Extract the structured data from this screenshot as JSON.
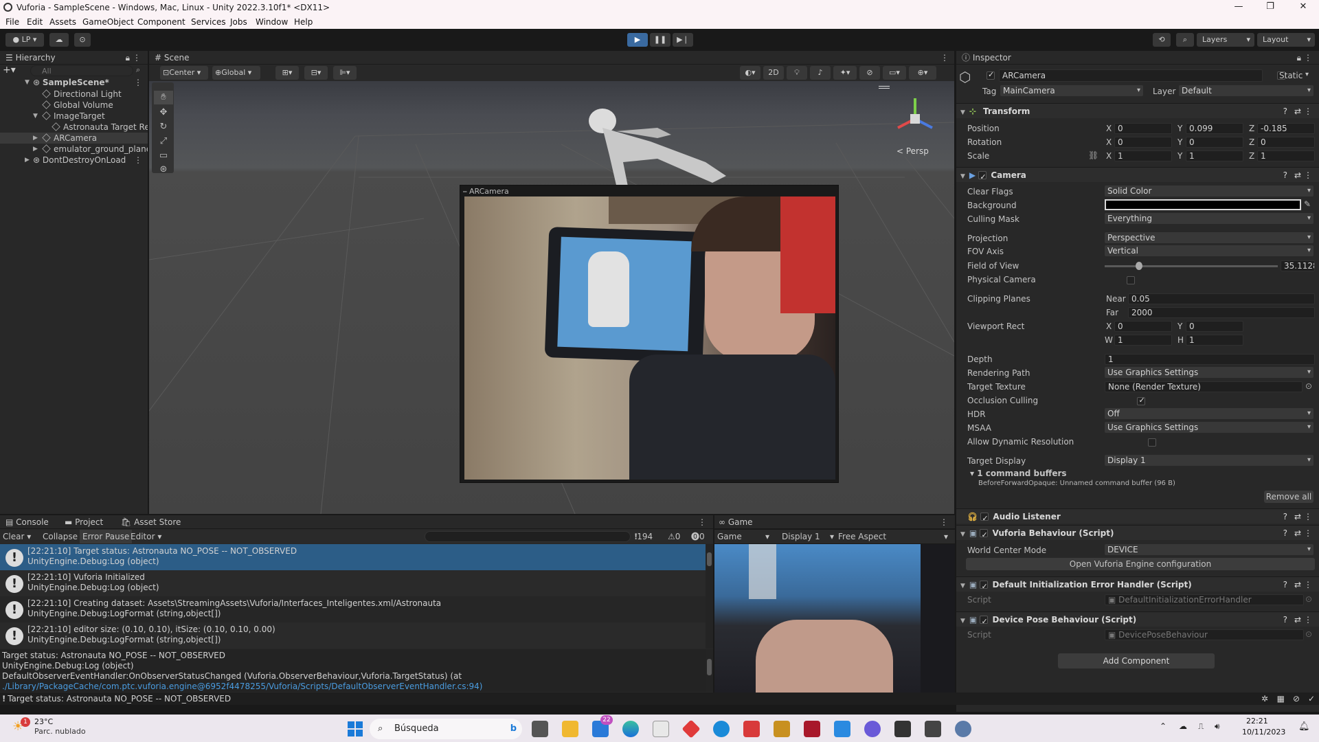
{
  "window": {
    "title": "Vuforia - SampleScene - Windows, Mac, Linux - Unity 2022.3.10f1* <DX11>"
  },
  "menu": [
    "File",
    "Edit",
    "Assets",
    "GameObject",
    "Component",
    "Services",
    "Jobs",
    "Window",
    "Help"
  ],
  "toolbar": {
    "account": "LP",
    "layers": "Layers",
    "layout": "Layout"
  },
  "hierarchy": {
    "tab": "Hierarchy",
    "search_placeholder": "All",
    "items": [
      {
        "label": "SampleScene*",
        "level": 0
      },
      {
        "label": "Directional Light",
        "level": 2
      },
      {
        "label": "Global Volume",
        "level": 2
      },
      {
        "label": "ImageTarget",
        "level": 1
      },
      {
        "label": "Astronauta Target Rep",
        "level": 3
      },
      {
        "label": "ARCamera",
        "level": 1
      },
      {
        "label": "emulator_ground_plane",
        "level": 1
      },
      {
        "label": "DontDestroyOnLoad",
        "level": 0
      }
    ]
  },
  "scene": {
    "tab": "Scene",
    "pivot": "Center",
    "space": "Global",
    "mode_2d": "2D",
    "persp": "< Persp",
    "preview_title": "ARCamera"
  },
  "inspector": {
    "tab": "Inspector",
    "object_name": "ARCamera",
    "static_label": "Static",
    "tag_label": "Tag",
    "tag": "MainCamera",
    "layer_label": "Layer",
    "layer": "Default",
    "transform": {
      "title": "Transform",
      "position_label": "Position",
      "position": [
        "0",
        "0.099",
        "-0.185"
      ],
      "rotation_label": "Rotation",
      "rotation": [
        "0",
        "0",
        "0"
      ],
      "scale_label": "Scale",
      "scale": [
        "1",
        "1",
        "1"
      ]
    },
    "camera": {
      "title": "Camera",
      "clear_flags_label": "Clear Flags",
      "clear_flags": "Solid Color",
      "background_label": "Background",
      "background_color": "#000000",
      "culling_mask_label": "Culling Mask",
      "culling_mask": "Everything",
      "projection_label": "Projection",
      "projection": "Perspective",
      "fov_axis_label": "FOV Axis",
      "fov_axis": "Vertical",
      "fov_label": "Field of View",
      "fov": "35.1128",
      "fov_fraction": 0.2,
      "physical_label": "Physical Camera",
      "clipping_label": "Clipping Planes",
      "near_label": "Near",
      "near": "0.05",
      "far_label": "Far",
      "far": "2000",
      "viewport_label": "Viewport Rect",
      "vx": "0",
      "vy": "0",
      "vw": "1",
      "vh": "1",
      "depth_label": "Depth",
      "depth": "1",
      "rendering_path_label": "Rendering Path",
      "rendering_path": "Use Graphics Settings",
      "target_texture_label": "Target Texture",
      "target_texture": "None (Render Texture)",
      "occlusion_label": "Occlusion Culling",
      "hdr_label": "HDR",
      "hdr": "Off",
      "msaa_label": "MSAA",
      "msaa": "Use Graphics Settings",
      "dynres_label": "Allow Dynamic Resolution",
      "target_display_label": "Target Display",
      "target_display": "Display 1",
      "cmd_buffers": "1 command buffers",
      "cmd_buffer_item": "BeforeForwardOpaque: Unnamed command buffer (96 B)",
      "remove_all": "Remove all"
    },
    "audio_listener": "Audio Listener",
    "vuforia_behaviour": {
      "title": "Vuforia Behaviour (Script)",
      "world_center_label": "World Center Mode",
      "world_center": "DEVICE",
      "open_config": "Open Vuforia Engine configuration"
    },
    "default_init": {
      "title": "Default Initialization Error Handler (Script)",
      "script_label": "Script",
      "script": "DefaultInitializationErrorHandler"
    },
    "device_pose": {
      "title": "Device Pose Behaviour (Script)",
      "script_label": "Script",
      "script": "DevicePoseBehaviour"
    },
    "add_component": "Add Component"
  },
  "console": {
    "tabs": [
      "Console",
      "Project",
      "Asset Store"
    ],
    "clear": "Clear",
    "collapse": "Collapse",
    "error_pause": "Error Pause",
    "editor": "Editor",
    "count_log": "194",
    "count_warn": "0",
    "count_err": "0",
    "entries": [
      {
        "l1": "[22:21:10] Target status: Astronauta NO_POSE -- NOT_OBSERVED",
        "l2": "UnityEngine.Debug:Log (object)"
      },
      {
        "l1": "[22:21:10] Vuforia Initialized",
        "l2": "UnityEngine.Debug:Log (object)"
      },
      {
        "l1": "[22:21:10] Creating dataset: Assets\\StreamingAssets\\Vuforia/Interfaces_Inteligentes.xml/Astronauta",
        "l2": "UnityEngine.Debug:LogFormat (string,object[])"
      },
      {
        "l1": "[22:21:10] editor size: (0.10, 0.10), itSize: (0.10, 0.10, 0.00)",
        "l2": "UnityEngine.Debug:LogFormat (string,object[])"
      }
    ],
    "detail": [
      "Target status: Astronauta NO_POSE -- NOT_OBSERVED",
      "UnityEngine.Debug:Log (object)",
      "DefaultObserverEventHandler:OnObserverStatusChanged (Vuforia.ObserverBehaviour,Vuforia.TargetStatus) (at"
    ],
    "detail_link": "./Library/PackageCache/com.ptc.vuforia.engine@6952f4478255/Vuforia/Scripts/DefaultObserverEventHandler.cs:94)"
  },
  "game": {
    "tab": "Game",
    "mode": "Game",
    "display": "Display 1",
    "aspect": "Free Aspect"
  },
  "statusbar": {
    "text": "Target status: Astronauta NO_POSE -- NOT_OBSERVED"
  },
  "taskbar": {
    "temp": "23°C",
    "weather": "Parc. nublado",
    "search": "Búsqueda",
    "time": "22:21",
    "date": "10/11/2023",
    "weather_badge": "1",
    "mail_badge": "22"
  }
}
